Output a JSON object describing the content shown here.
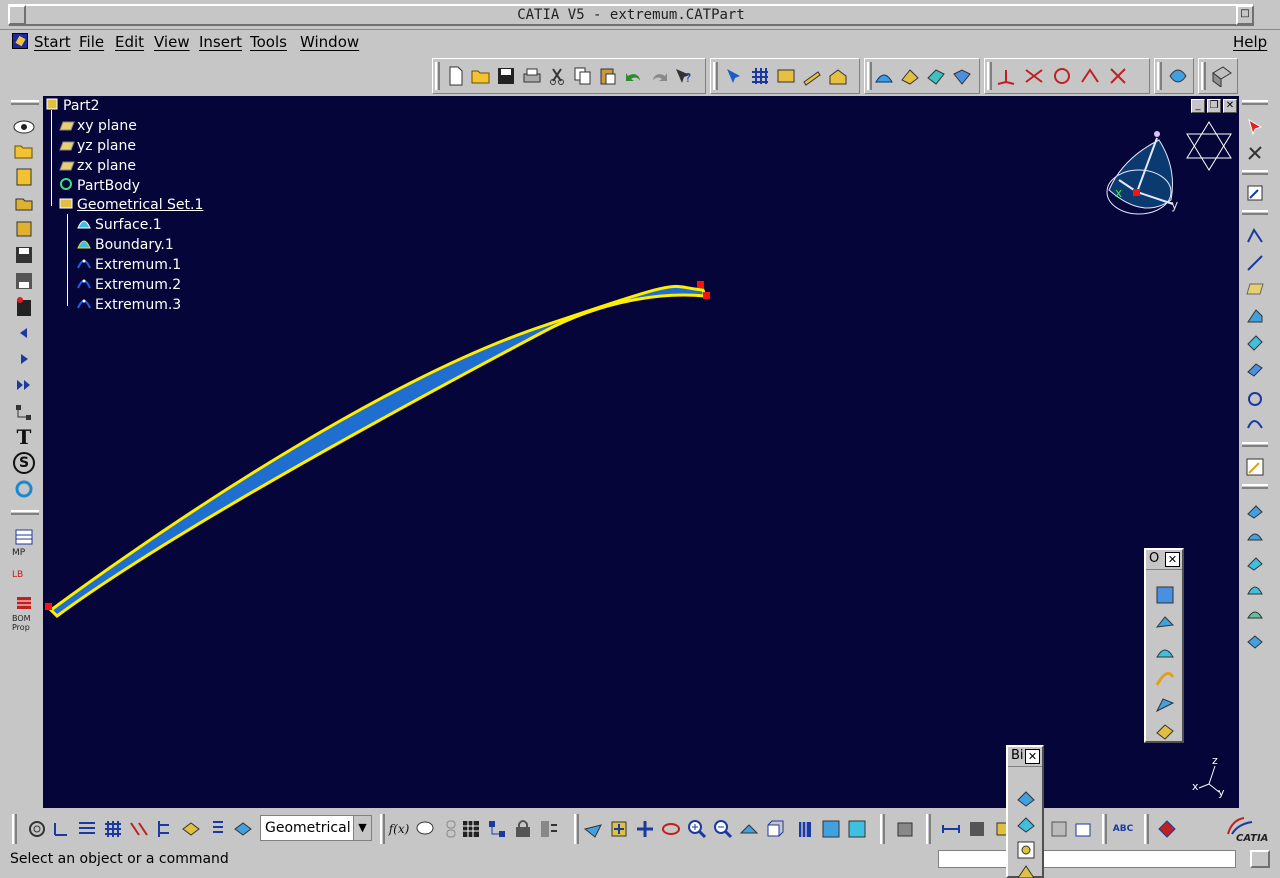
{
  "window": {
    "title": "CATIA V5 - extremum.CATPart",
    "minimize_glyph": "_",
    "close_glyph": "□"
  },
  "menu": {
    "items": [
      {
        "label": "Start"
      },
      {
        "label": "File"
      },
      {
        "label": "Edit"
      },
      {
        "label": "View"
      },
      {
        "label": "Insert"
      },
      {
        "label": "Tools"
      },
      {
        "label": "Window"
      }
    ],
    "help": "Help"
  },
  "tree": {
    "root": "Part2",
    "nodes": [
      {
        "label": "xy plane",
        "icon": "plane-icon"
      },
      {
        "label": "yz plane",
        "icon": "plane-icon"
      },
      {
        "label": "zx plane",
        "icon": "plane-icon"
      },
      {
        "label": "PartBody",
        "icon": "partbody-icon"
      },
      {
        "label": "Geometrical Set.1",
        "icon": "geometrical-set-icon"
      },
      {
        "label": "Surface.1",
        "icon": "surface-icon"
      },
      {
        "label": "Boundary.1",
        "icon": "boundary-icon"
      },
      {
        "label": "Extremum.1",
        "icon": "extremum-icon"
      },
      {
        "label": "Extremum.2",
        "icon": "extremum-icon"
      },
      {
        "label": "Extremum.3",
        "icon": "extremum-icon"
      }
    ]
  },
  "compass": {
    "x_label": "x",
    "y_label": "y"
  },
  "axis_triad": {
    "x": "x",
    "y": "y",
    "z": "z"
  },
  "mdi_buttons": [
    "_",
    "❐",
    "✕"
  ],
  "palettes": {
    "operations_title": "O",
    "bottom_title": "Bi",
    "close_glyph": "✕"
  },
  "left_toolbar": {
    "text_icon": "T",
    "s_icon": "S",
    "mp_label": "MP",
    "lb_label": "LB",
    "bom_label": "BOM",
    "prop_label": "Prop"
  },
  "bottom_toolbar": {
    "combo_value": "Geometrical",
    "combo_arrow": "▼",
    "formula_icon": "f(x)",
    "abc_label": "ABC"
  },
  "status": {
    "prompt": "Select an object or a command",
    "input_value": ""
  },
  "brand": {
    "logo_text": "CATIA"
  },
  "colors": {
    "viewport_bg": "#05053a",
    "curve_fill": "#1f6fd0",
    "curve_edge": "#ffee00",
    "point_marker": "#ff1010",
    "ui_gray": "#c6c6c6"
  }
}
